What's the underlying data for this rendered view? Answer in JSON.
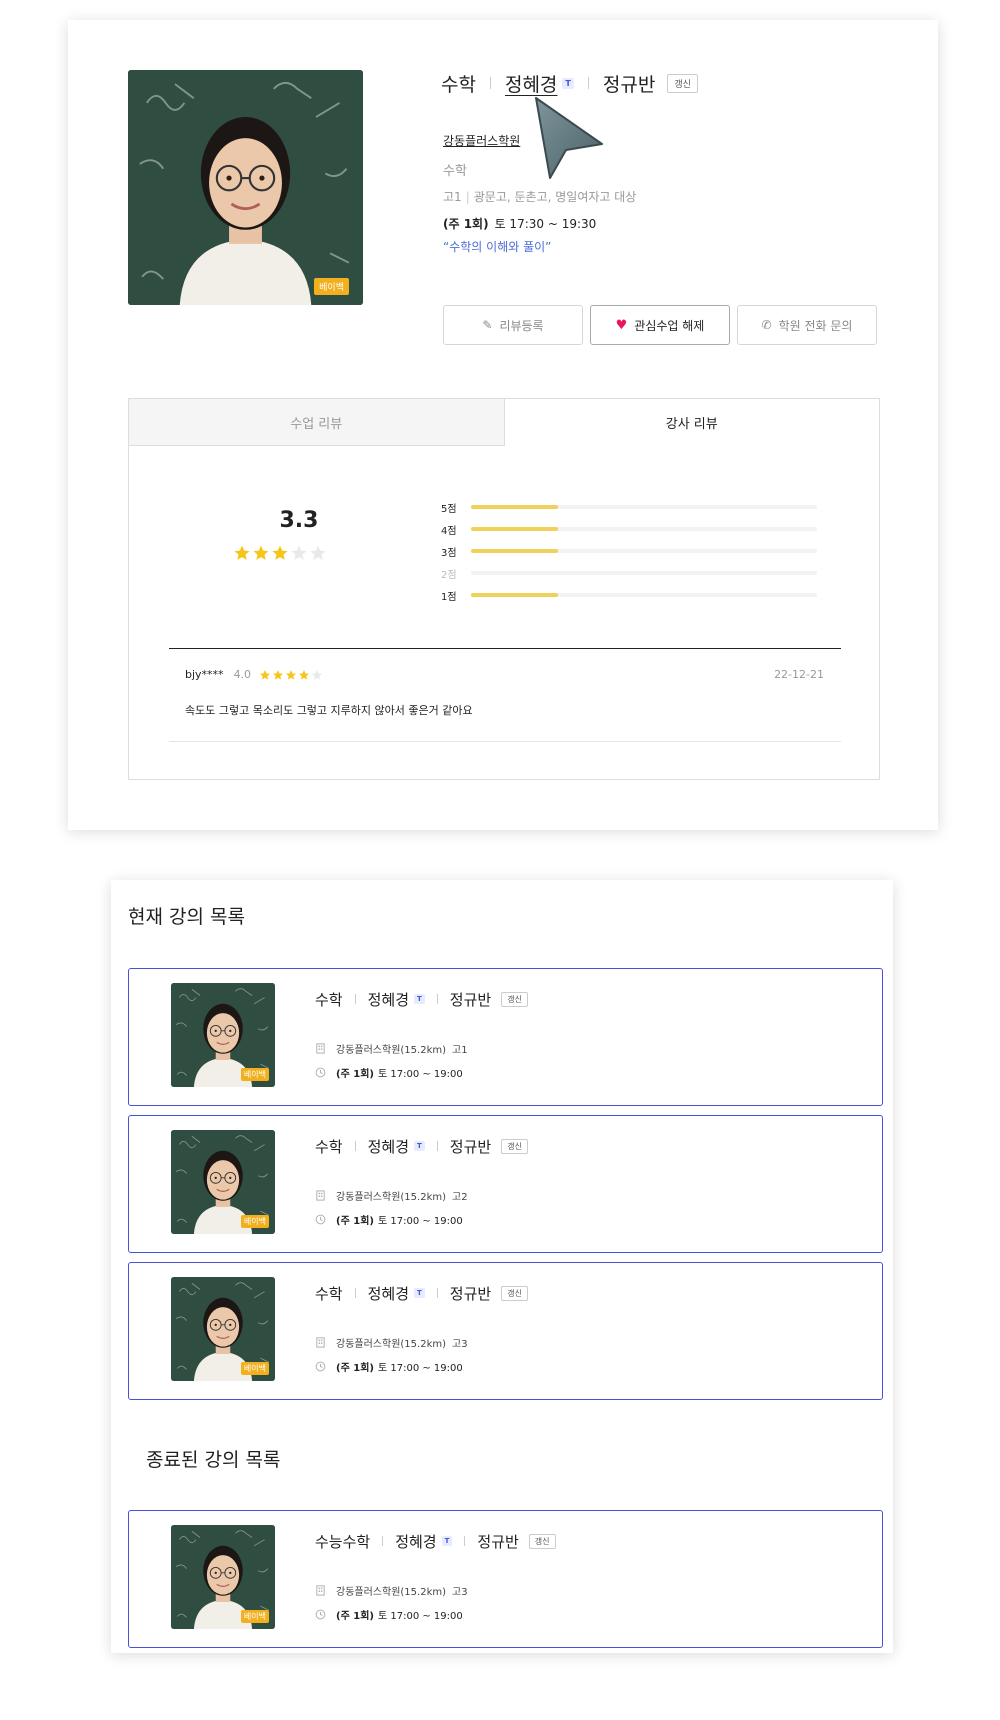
{
  "detail": {
    "subject": "수학",
    "teacher": "정혜경",
    "teacher_badge": "T",
    "class_type": "정규반",
    "tag": "갱신",
    "photo_badge": "베이백",
    "academy": "강동플러스학원",
    "subject_sub": "수학",
    "grade": "고1",
    "schools": "광문고, 둔촌고, 명일여자고 대상",
    "frequency": "(주 1회)",
    "time": "토 17:30 ~ 19:30",
    "quote": "“수학의 이해와 풀이”"
  },
  "buttons": {
    "review": "리뷰등록",
    "favorite": "관심수업 해제",
    "call": "학원 전화 문의"
  },
  "tabs": {
    "class_review": "수업 리뷰",
    "teacher_review": "강사 리뷰"
  },
  "rating": {
    "average": "3.3",
    "average_value": 3.3,
    "bars": [
      {
        "label": "5점",
        "ratio": 0.25,
        "dim": false
      },
      {
        "label": "4점",
        "ratio": 0.25,
        "dim": false
      },
      {
        "label": "3점",
        "ratio": 0.25,
        "dim": false
      },
      {
        "label": "2점",
        "ratio": 0,
        "dim": true
      },
      {
        "label": "1점",
        "ratio": 0.25,
        "dim": false
      }
    ]
  },
  "review": {
    "user": "bjy****",
    "score": "4.0",
    "score_value": 4,
    "date": "22-12-21",
    "text": "속도도 그렇고 목소리도 그렇고 지루하지 않아서 좋은거 같아요"
  },
  "current_section_title": "현재 강의 목록",
  "ended_section_title": "종료된 강의 목록",
  "current_lectures": [
    {
      "subject": "수학",
      "teacher": "정혜경",
      "badge": "T",
      "class_type": "정규반",
      "tag": "갱신",
      "photo_badge": "베이백",
      "academy": "강동플러스학원(15.2km)",
      "grade": "고1",
      "frequency": "(주 1회)",
      "time": "토 17:00 ~ 19:00"
    },
    {
      "subject": "수학",
      "teacher": "정혜경",
      "badge": "T",
      "class_type": "정규반",
      "tag": "갱신",
      "photo_badge": "베이백",
      "academy": "강동플러스학원(15.2km)",
      "grade": "고2",
      "frequency": "(주 1회)",
      "time": "토 17:00 ~ 19:00"
    },
    {
      "subject": "수학",
      "teacher": "정혜경",
      "badge": "T",
      "class_type": "정규반",
      "tag": "갱신",
      "photo_badge": "베이백",
      "academy": "강동플러스학원(15.2km)",
      "grade": "고3",
      "frequency": "(주 1회)",
      "time": "토 17:00 ~ 19:00"
    }
  ],
  "ended_lectures": [
    {
      "subject": "수능수학",
      "teacher": "정혜경",
      "badge": "T",
      "class_type": "정규반",
      "tag": "갱신",
      "photo_badge": "베이백",
      "academy": "강동플러스학원(15.2km)",
      "grade": "고3",
      "frequency": "(주 1회)",
      "time": "토 17:00 ~ 19:00"
    }
  ],
  "colors": {
    "accent_blue": "#4a4fd8",
    "star_yellow": "#f5c518",
    "bar_yellow": "#f0d15a",
    "heart_pink": "#e8175d",
    "badge_orange": "#f2b01e"
  }
}
